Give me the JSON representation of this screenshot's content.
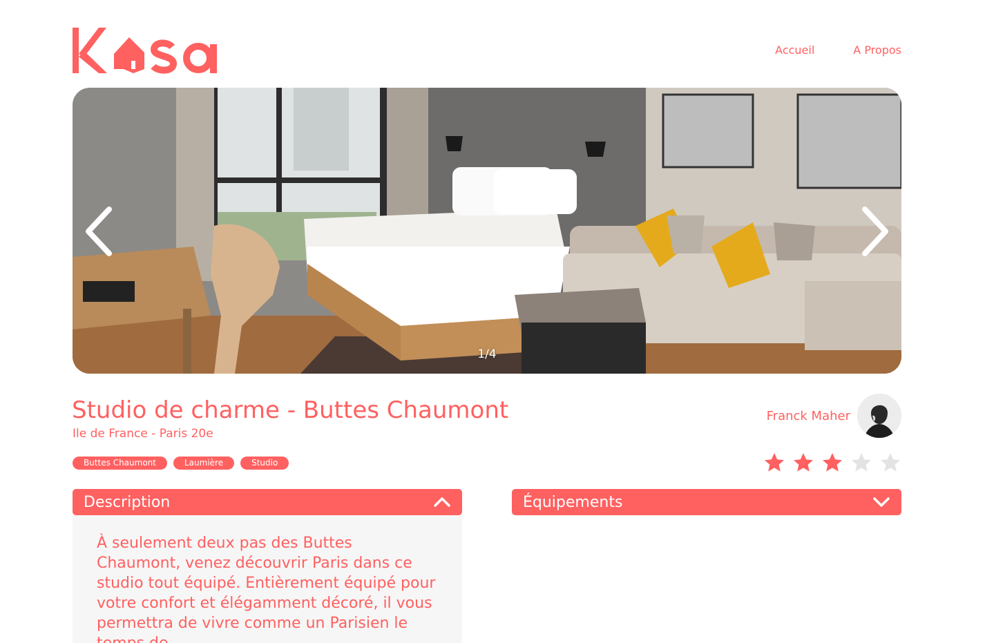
{
  "brand": {
    "logo_text": "Kasa",
    "accent_color": "#FF6060"
  },
  "nav": {
    "items": [
      {
        "label": "Accueil"
      },
      {
        "label": "A Propos"
      }
    ]
  },
  "gallery": {
    "current": 1,
    "total": 4,
    "counter_text": "1/4",
    "prev_icon": "chevron-left-icon",
    "next_icon": "chevron-right-icon"
  },
  "listing": {
    "title": "Studio de charme - Buttes Chaumont",
    "location": "Ile de France - Paris 20e",
    "tags": [
      "Buttes Chaumont",
      "Laumière",
      "Studio"
    ],
    "rating": 3,
    "rating_max": 5
  },
  "host": {
    "name": "Franck Maher"
  },
  "collapses": {
    "description": {
      "title": "Description",
      "state": "open",
      "icon": "chevron-up-icon",
      "text": "À seulement deux pas des Buttes Chaumont, venez découvrir Paris dans ce studio tout équipé. Entièrement équipé pour votre confort et élégamment décoré, il vous permettra de vivre comme un Parisien le temps de"
    },
    "equipments": {
      "title": "Équipements",
      "state": "closed",
      "icon": "chevron-down-icon"
    }
  }
}
